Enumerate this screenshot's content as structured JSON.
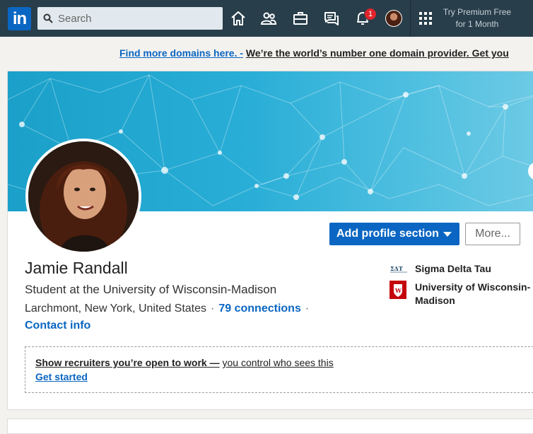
{
  "nav": {
    "logo_text": "in",
    "search_placeholder": "Search",
    "notification_count": "1",
    "premium_line1": "Try Premium Free",
    "premium_line2": "for 1 Month",
    "icons": [
      "home-icon",
      "my-network-icon",
      "jobs-icon",
      "messaging-icon",
      "notifications-icon",
      "work-grid-icon"
    ]
  },
  "ad": {
    "link_text": "Find more domains here. -",
    "message": "We’re the world’s number one domain provider. Get you"
  },
  "profile": {
    "name": "Jamie Randall",
    "headline": "Student at the University of Wisconsin-Madison",
    "location": "Larchmont, New York, United States",
    "connections": "79 connections",
    "contact_info": "Contact info",
    "add_section_label": "Add profile section",
    "more_label": "More...",
    "affiliations": [
      {
        "name": "Sigma Delta Tau",
        "icon": "sigma-delta-tau-logo-icon"
      },
      {
        "name": "University of Wisconsin-Madison",
        "icon": "uw-madison-logo-icon"
      }
    ],
    "open_to_work": {
      "prompt_bold": "Show recruiters you’re open to work —",
      "prompt_rest": "you control who sees this",
      "cta": "Get started"
    }
  },
  "colors": {
    "nav_bg": "#283e4a",
    "brand_blue": "#0a66c2",
    "banner": "#29aed7",
    "badge": "#e0242b"
  }
}
